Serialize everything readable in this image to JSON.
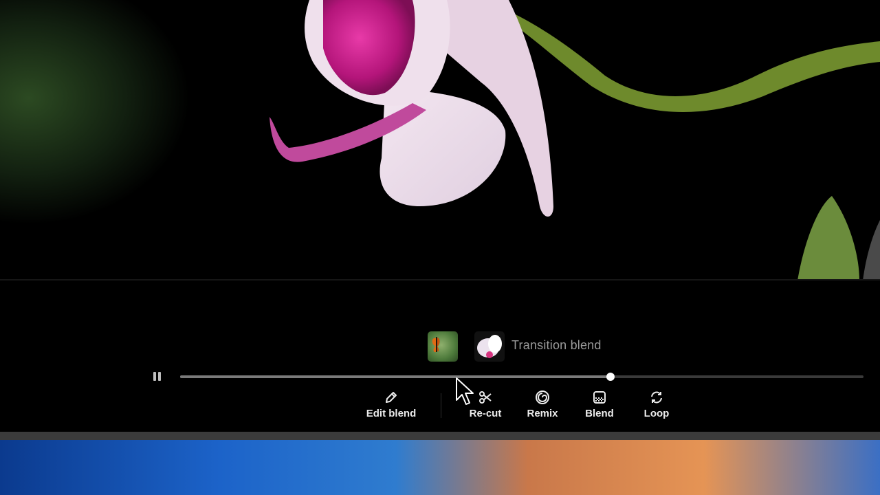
{
  "video": {
    "scene": "orchid-flower-on-black"
  },
  "clips": {
    "thumb_a": "butterfly-on-green-thumbnail",
    "thumb_b": "orchid-thumbnail",
    "transition_label": "Transition blend"
  },
  "playback": {
    "state_icon": "pause-icon",
    "progress": 0.63
  },
  "toolbar": {
    "edit_blend": "Edit blend",
    "recut": "Re-cut",
    "remix": "Remix",
    "blend": "Blend",
    "loop": "Loop"
  },
  "colors": {
    "background": "#000000",
    "label_muted": "#9a9a9a",
    "track": "#3a3a3a",
    "knob": "#ffffff"
  }
}
